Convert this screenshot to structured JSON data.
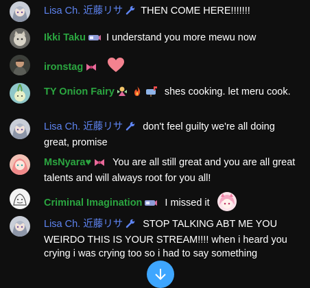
{
  "messages": [
    {
      "author": "Lisa Ch. 近藤リサ",
      "role": "mod",
      "text": "THEN COME HERE!!!!!!!",
      "avatar": "anime-girl-avatar",
      "badge": "wrench-icon"
    },
    {
      "author": "Ikki Taku",
      "role": "member",
      "text": "I understand you more mewu now",
      "avatar": "cat-avatar",
      "badge": "member-badge-icon"
    },
    {
      "author": "ironstag",
      "role": "member",
      "text": "",
      "avatar": "man-avatar",
      "badge": "bow-icon",
      "emoji": "heart-emoji"
    },
    {
      "author": "TY Onion Fairy",
      "role": "member",
      "text": "shes cooking. let meru cook.",
      "avatar": "onion-avatar",
      "badges": [
        "fairy-icon",
        "fire-icon",
        "mailbox-icon"
      ]
    },
    {
      "author": "Lisa Ch. 近藤リサ",
      "role": "mod",
      "text": "don't feel guilty we're all doing great, promise",
      "avatar": "anime-girl-avatar",
      "badge": "wrench-icon"
    },
    {
      "author": "MsNyara♥",
      "role": "member",
      "text": "You are all still great and you are all great talents and will always root for you all!",
      "avatar": "pink-hair-avatar",
      "badge": "bow-icon"
    },
    {
      "author": "Criminal Imagination",
      "role": "member",
      "text": "I missed it",
      "avatar": "sketch-avatar",
      "badge": "member-badge-icon",
      "emoji": "vtuber-sticker-emoji"
    },
    {
      "author": "Lisa Ch. 近藤リサ",
      "role": "mod",
      "text": "STOP TALKING ABT ME YOU WEIRDO THIS IS YOUR STREAM!!!! when i heard you crying i was crying too so i had to say something",
      "avatar": "anime-girl-avatar",
      "badge": "wrench-icon"
    }
  ],
  "colors": {
    "background": "#0f0f0f",
    "moderator_name": "#5e84f1",
    "member_name": "#2ba640",
    "scroll_button": "#3ea6ff"
  },
  "scroll_button_icon": "arrow-down-icon"
}
